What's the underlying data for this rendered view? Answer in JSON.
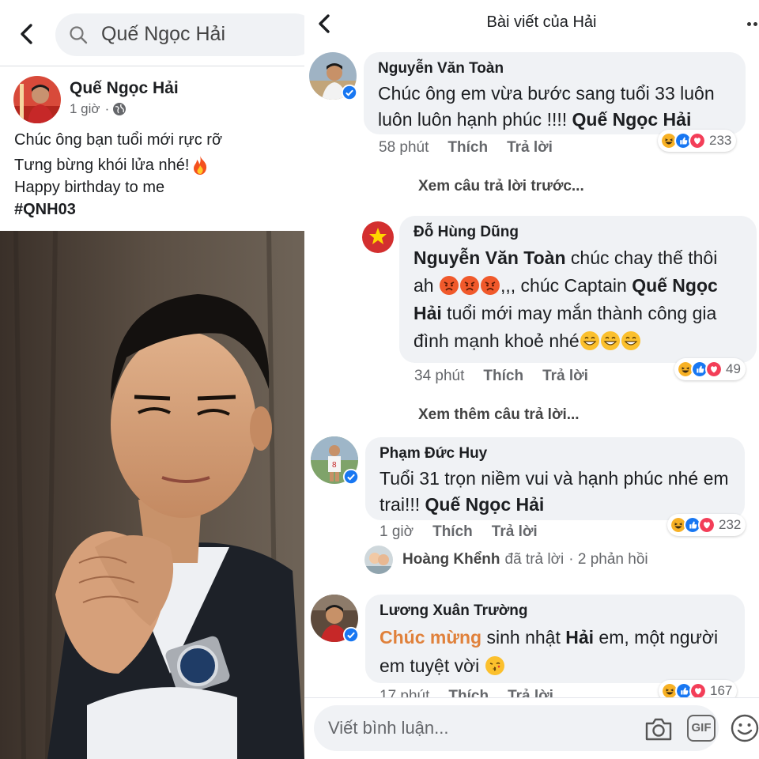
{
  "left": {
    "search_query": "Quế Ngọc Hải",
    "post": {
      "author": "Quế Ngọc Hải",
      "time": "1 giờ",
      "separator": "·",
      "lines": [
        "Chúc ông bạn tuổi mới rực rỡ",
        "Tưng bừng khói lửa nhé!",
        "Happy birthday to me"
      ],
      "hashtag": "#QNH03"
    }
  },
  "right": {
    "title": "Bài viết của Hải",
    "comments": [
      {
        "name": "Nguyễn Văn Toàn",
        "text": "Chúc ông em vừa bước sang tuổi 33 luôn luôn luôn hạnh phúc !!!! ",
        "mention": "Quế Ngọc Hải",
        "time": "58 phút",
        "like": "Thích",
        "reply": "Trả lời",
        "reactions": "233"
      },
      {
        "name": "Đỗ Hùng Dũng",
        "mention1": "Nguyễn Văn Toàn",
        "text1": " chúc chay thế thôi ah ",
        "text2": ",,, chúc Captain ",
        "mention2": "Quế Ngọc Hải",
        "text3": " tuổi mới may mắn thành công gia đình mạnh khoẻ nhé",
        "time": "34 phút",
        "like": "Thích",
        "reply": "Trả lời",
        "reactions": "49"
      },
      {
        "name": "Phạm Đức Huy",
        "text": "Tuổi 31 trọn niềm vui và hạnh phúc nhé em trai!!! ",
        "mention": "Quế Ngọc Hải",
        "time": "1 giờ",
        "like": "Thích",
        "reply": "Trả lời",
        "reactions": "232"
      },
      {
        "name": "Lương Xuân Trường",
        "highlight": "Chúc mừng",
        "text1": " sinh nhật ",
        "bold": "Hải",
        "text2": " em, một người em tuyệt vời ",
        "time": "17 phút",
        "like": "Thích",
        "reply": "Trả lời",
        "reactions": "167"
      }
    ],
    "see_previous": "Xem câu trả lời trước...",
    "see_more": "Xem thêm câu trả lời...",
    "reply_summary": {
      "name": "Hoàng Khểnh",
      "action": "đã trả lời",
      "count": "· 2 phản hồi"
    },
    "composer": {
      "placeholder": "Viết bình luận...",
      "gif_label": "GIF"
    }
  },
  "colors": {
    "bubble": "#f0f2f5",
    "mention_highlight": "#e0813b",
    "like_blue": "#1877f2",
    "love_red": "#f33e58",
    "haha_yellow": "#f7b125"
  },
  "icons": [
    "back-icon",
    "search-icon",
    "globe-icon",
    "fire-emoji",
    "verified-icon",
    "haha-reaction-icon",
    "like-reaction-icon",
    "love-reaction-icon",
    "angry-emoji",
    "grin-emoji",
    "kiss-emoji",
    "camera-icon",
    "gif-icon",
    "smiley-icon",
    "more-icon"
  ]
}
